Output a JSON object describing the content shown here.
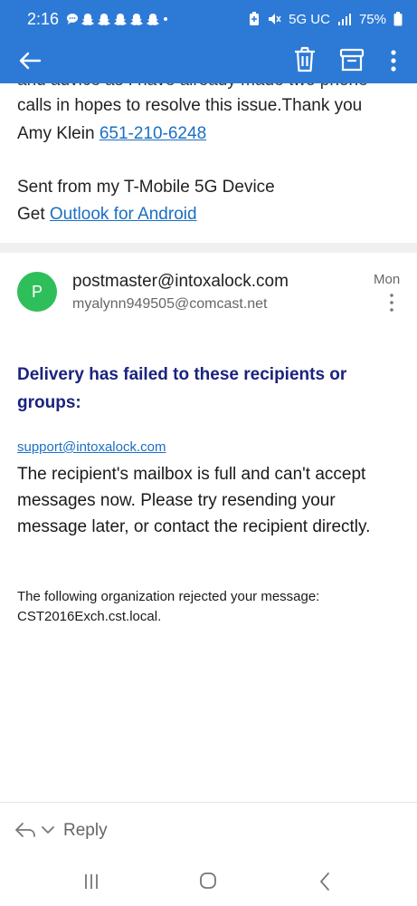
{
  "status_bar": {
    "time": "2:16",
    "network": "5G UC",
    "battery": "75%",
    "icons": [
      "chat-bubble-icon",
      "snapchat-icon",
      "snapchat-icon",
      "snapchat-icon",
      "snapchat-icon",
      "snapchat-icon",
      "dot-icon",
      "battery-saver-icon",
      "mute-icon",
      "signal-icon",
      "battery-icon"
    ]
  },
  "toolbar": {
    "back_icon": "arrow-left-icon",
    "delete_icon": "trash-icon",
    "archive_icon": "archive-icon",
    "more_icon": "more-vertical-icon",
    "bg_color": "#2d7ad6"
  },
  "previous_message": {
    "cut_line": "and advice as I have already made two phone",
    "line1": "calls in hopes to resolve this issue.Thank you",
    "signature_name": "Amy Klein",
    "signature_phone": "651-210-6248",
    "sent_from": "Sent from my T-Mobile 5G Device",
    "get_prefix": "Get",
    "outlook_link": "Outlook for Android"
  },
  "message": {
    "avatar_letter": "P",
    "avatar_color": "#2fbf5a",
    "from": "postmaster@intoxalock.com",
    "to": "myalynn949505@comcast.net",
    "date": "Mon",
    "title": "Delivery has failed to these recipients or groups:",
    "recipient_link": "support@intoxalock.com",
    "body": "The recipient's mailbox is full and can't accept messages now. Please try resending your message later, or contact the recipient directly.",
    "org_line1": "The following organization rejected your message:",
    "org_line2": "CST2016Exch.cst.local."
  },
  "reply_bar": {
    "label": "Reply"
  },
  "colors": {
    "accent": "#2d7ad6",
    "link": "#1b6fc2",
    "title": "#1a237e"
  }
}
